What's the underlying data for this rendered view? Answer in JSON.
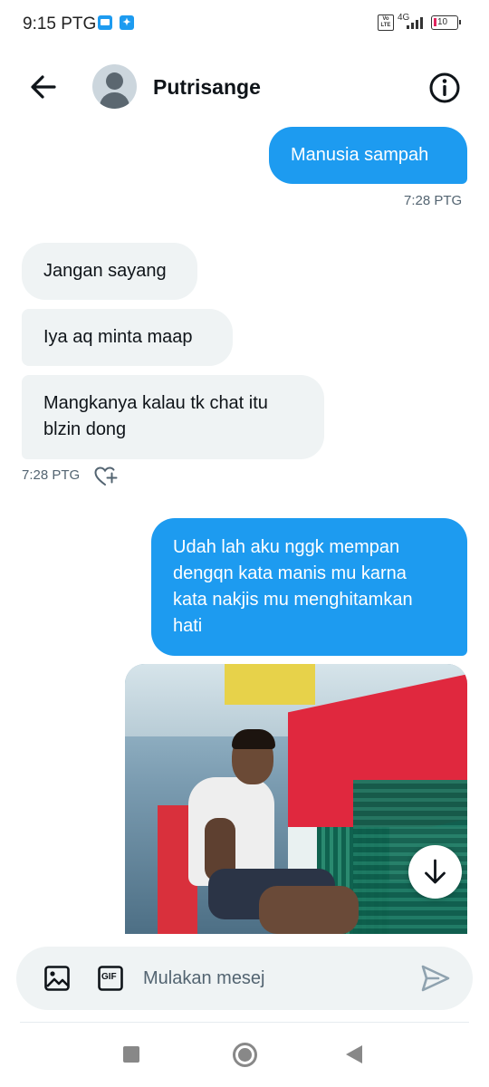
{
  "status_bar": {
    "time": "9:15 PTG",
    "network": "4G",
    "volte": "Vo LTE",
    "battery": "10"
  },
  "header": {
    "title": "Putrisange",
    "back_icon": "arrow-left-icon",
    "info_icon": "info-icon"
  },
  "messages": [
    {
      "direction": "out",
      "text": "Manusia sampah"
    },
    {
      "direction": "in",
      "text": "Jangan sayang"
    },
    {
      "direction": "in",
      "text": "Iya aq minta maap"
    },
    {
      "direction": "in",
      "text_lines": [
        "Mangkanya kalau tk chat itu",
        "blzin dong"
      ]
    },
    {
      "direction": "out",
      "text_lines": [
        "Udah lah aku nggk mempan",
        "dengqn kata manis mu karna",
        "kata nakjis mu menghitamkan",
        "hati"
      ]
    }
  ],
  "timestamps": {
    "first_out": "7:28 PTG",
    "incoming_group": "7:28 PTG"
  },
  "composer": {
    "placeholder": "Mulakan mesej",
    "gif_label": "GIF"
  },
  "colors": {
    "accent": "#1d9bf0",
    "incoming_bubble": "#eff3f4",
    "secondary_text": "#536471"
  }
}
